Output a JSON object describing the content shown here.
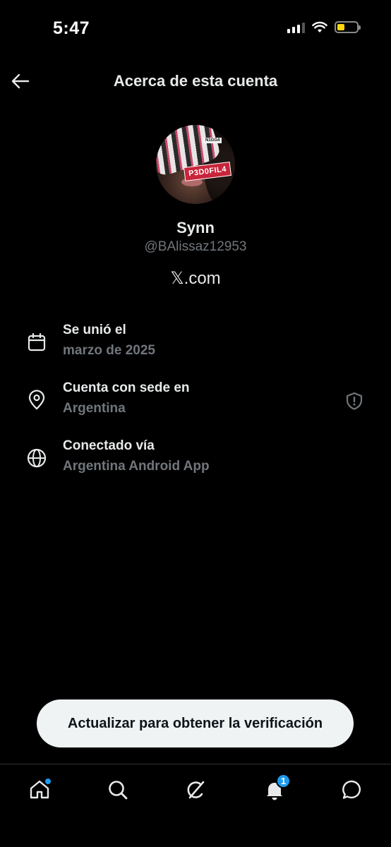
{
  "status_bar": {
    "time": "5:47",
    "icons": [
      "signal-icon",
      "wifi-icon",
      "battery-icon"
    ],
    "battery_color": "#ffd60a"
  },
  "header": {
    "title": "Acerca de esta cuenta",
    "back_icon": "back-arrow-icon"
  },
  "profile": {
    "avatar_labels": {
      "big": "P3D0FIL4",
      "small": "N1GG4"
    },
    "display_name": "Synn",
    "handle": "@BAlissaz12953",
    "site": "𝕏.com"
  },
  "info": [
    {
      "icon": "calendar-icon",
      "title": "Se unió el",
      "value": "marzo de 2025"
    },
    {
      "icon": "location-pin-icon",
      "title": "Cuenta con sede en",
      "value": "Argentina",
      "action_icon": "shield-icon"
    },
    {
      "icon": "globe-icon",
      "title": "Conectado vía",
      "value": "Argentina Android App"
    }
  ],
  "cta": {
    "label": "Actualizar para obtener la verificación"
  },
  "bottom_nav": {
    "items": [
      "home-icon",
      "search-icon",
      "grok-icon",
      "notifications-icon",
      "messages-icon"
    ],
    "notifications_badge": "1"
  },
  "colors": {
    "background": "#000000",
    "primary_text": "#e7e9ea",
    "secondary_text": "#71767b",
    "accent": "#1d9bf0",
    "cta_background": "#eff3f4"
  }
}
